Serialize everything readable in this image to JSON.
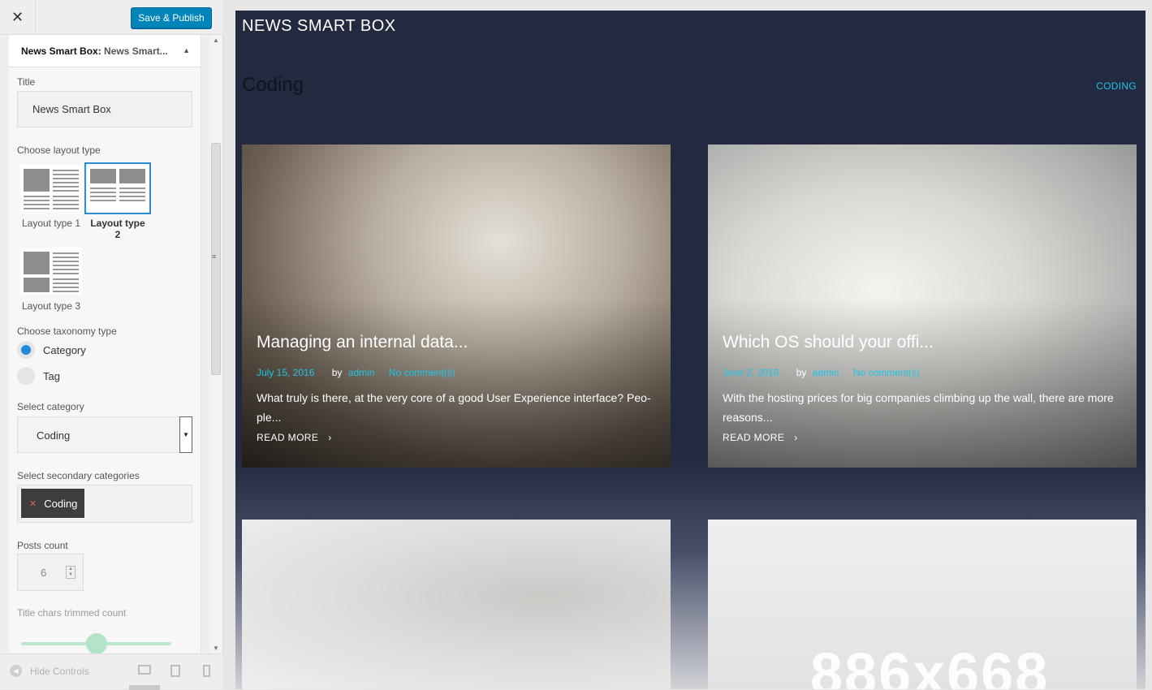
{
  "topbar": {
    "close_icon": "close-icon",
    "save_label": "Save & Publish"
  },
  "section": {
    "title": "News Smart Box:",
    "subtitle": "News Smart...",
    "collapse_icon": "triangle-up-icon"
  },
  "fields": {
    "title_label": "Title",
    "title_value": "News Smart Box",
    "layout_label": "Choose layout type",
    "layouts": [
      {
        "label": "Layout type 1",
        "selected": false
      },
      {
        "label": "Layout type 2",
        "selected": true
      },
      {
        "label": "Layout type 3",
        "selected": false
      }
    ],
    "taxonomy_label": "Choose taxonomy type",
    "taxonomy_options": [
      {
        "label": "Category",
        "checked": true
      },
      {
        "label": "Tag",
        "checked": false
      }
    ],
    "category_label": "Select category",
    "category_value": "Coding",
    "secondary_label": "Select secondary categories",
    "secondary_tags": [
      "Coding"
    ],
    "posts_count_label": "Posts count",
    "posts_count_value": "6",
    "trim_label": "Title chars trimmed count",
    "trim_slider_fraction": 0.48
  },
  "footer": {
    "hide_label": "Hide Controls",
    "devices": [
      "desktop-icon",
      "tablet-icon",
      "mobile-icon"
    ],
    "active_device": "desktop"
  },
  "preview": {
    "widget_title": "NEWS SMART BOX",
    "category_title": "Coding",
    "category_link": "CODING",
    "accent_color": "#1cc5e8",
    "cards": [
      {
        "title": "Managing an internal data...",
        "date": "July 15, 2016",
        "by": "by",
        "author": "admin",
        "comments": "No comment(s)",
        "excerpt": "What truly is there, at the very core of a good User Experience interface? Peo- ple...",
        "more": "READ MORE"
      },
      {
        "title": "Which OS should your offi...",
        "date": "June 2, 2016",
        "by": "by",
        "author": "admin",
        "comments": "No comment(s)",
        "excerpt": "With the hosting prices for big companies climbing up the wall, there are more reasons...",
        "more": "READ MORE"
      }
    ],
    "placeholder_text": "886x668"
  }
}
